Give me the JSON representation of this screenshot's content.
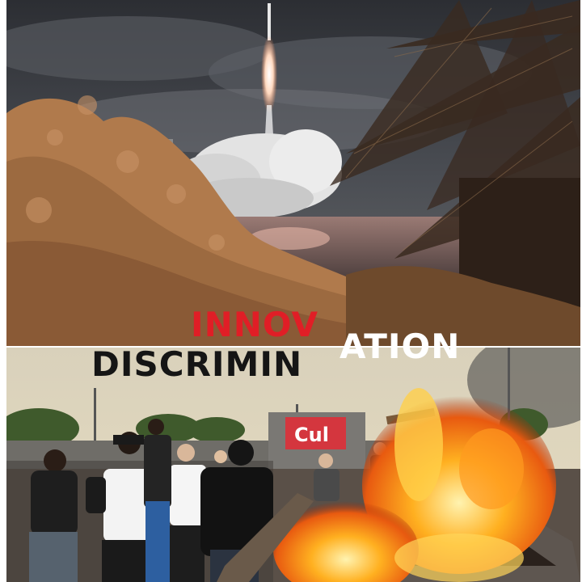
{
  "colors": {
    "overlay_red": "#e01e26",
    "overlay_white": "#ffffff",
    "overlay_black": "#151515"
  },
  "overlay": {
    "word_part_1": "INNOV",
    "word_part_2": "ATION",
    "word_part_3": "DISCRIMIN"
  },
  "photos": {
    "bottom_sign_text": "Cul"
  }
}
